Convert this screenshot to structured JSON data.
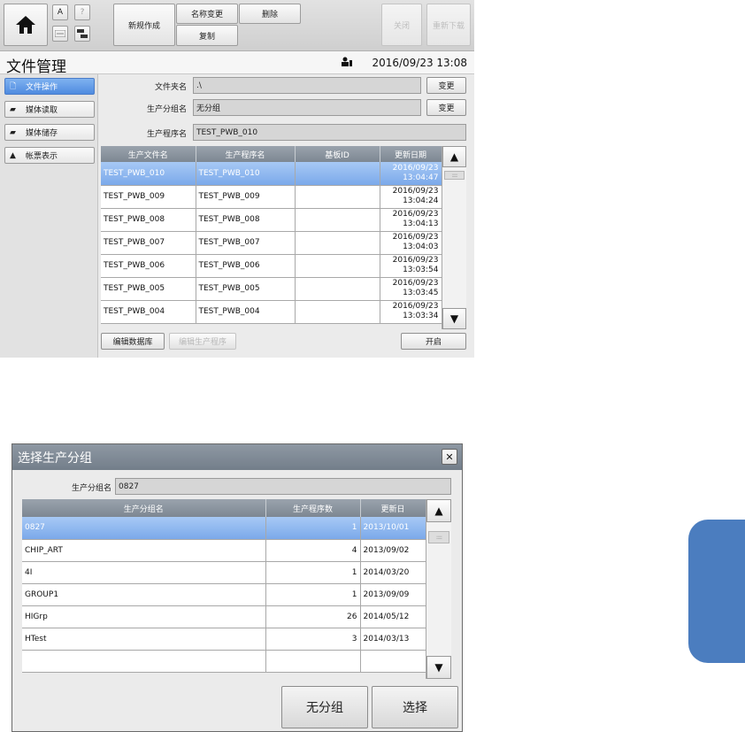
{
  "toolbar": {
    "home_icon": "home-icon",
    "small_icons": [
      "document-icon",
      "help-icon",
      "keyboard-icon",
      "network-icon"
    ],
    "small_icon_labels": [
      "A",
      "?",
      "",
      ""
    ],
    "new_create": "新规作成",
    "rename": "名称变更",
    "delete": "删除",
    "copy": "复制",
    "close": "关闭",
    "reload": "重新下载"
  },
  "header": {
    "title": "文件管理",
    "datetime": "2016/09/23 13:08"
  },
  "sidebar": {
    "items": [
      {
        "label": "文件操作",
        "icon": "file-icon"
      },
      {
        "label": "媒体读取",
        "icon": "media-read-icon"
      },
      {
        "label": "媒体储存",
        "icon": "media-save-icon"
      },
      {
        "label": "帐票表示",
        "icon": "report-icon"
      }
    ]
  },
  "form": {
    "folder_label": "文件夹名",
    "folder_value": ".\\",
    "group_label": "生产分组名",
    "group_value": "无分组",
    "program_label": "生产程序名",
    "program_value": "TEST_PWB_010",
    "change_label": "变更"
  },
  "file_table": {
    "columns": [
      "生产文件名",
      "生产程序名",
      "基板ID",
      "更新日期"
    ],
    "rows": [
      {
        "file": "TEST_PWB_010",
        "program": "TEST_PWB_010",
        "board": "",
        "date": "2016/09/23",
        "time": "13:04:47"
      },
      {
        "file": "TEST_PWB_009",
        "program": "TEST_PWB_009",
        "board": "",
        "date": "2016/09/23",
        "time": "13:04:24"
      },
      {
        "file": "TEST_PWB_008",
        "program": "TEST_PWB_008",
        "board": "",
        "date": "2016/09/23",
        "time": "13:04:13"
      },
      {
        "file": "TEST_PWB_007",
        "program": "TEST_PWB_007",
        "board": "",
        "date": "2016/09/23",
        "time": "13:04:03"
      },
      {
        "file": "TEST_PWB_006",
        "program": "TEST_PWB_006",
        "board": "",
        "date": "2016/09/23",
        "time": "13:03:54"
      },
      {
        "file": "TEST_PWB_005",
        "program": "TEST_PWB_005",
        "board": "",
        "date": "2016/09/23",
        "time": "13:03:45"
      },
      {
        "file": "TEST_PWB_004",
        "program": "TEST_PWB_004",
        "board": "",
        "date": "2016/09/23",
        "time": "13:03:34"
      }
    ],
    "selected_index": 0
  },
  "bottom_actions": {
    "edit_db": "编辑数据库",
    "edit_program": "编辑生产程序",
    "open": "开启"
  },
  "dialog": {
    "title": "选择生产分组",
    "group_label": "生产分组名",
    "group_value": "0827",
    "columns": [
      "生产分组名",
      "生产程序数",
      "更新日"
    ],
    "rows": [
      {
        "name": "0827",
        "count": "1",
        "date": "2013/10/01"
      },
      {
        "name": "CHIP_ART",
        "count": "4",
        "date": "2013/09/02"
      },
      {
        "name": "4I",
        "count": "1",
        "date": "2014/03/20"
      },
      {
        "name": "GROUP1",
        "count": "1",
        "date": "2013/09/09"
      },
      {
        "name": "HIGrp",
        "count": "26",
        "date": "2014/05/12"
      },
      {
        "name": "HTest",
        "count": "3",
        "date": "2014/03/13"
      },
      {
        "name": "",
        "count": "",
        "date": ""
      }
    ],
    "selected_index": 0,
    "no_group_button": "无分组",
    "select_button": "选择"
  },
  "colors": {
    "selection": "#7ba9ea",
    "header_gray": "#7d8792",
    "side_tab_blue": "#4b7dbf"
  }
}
